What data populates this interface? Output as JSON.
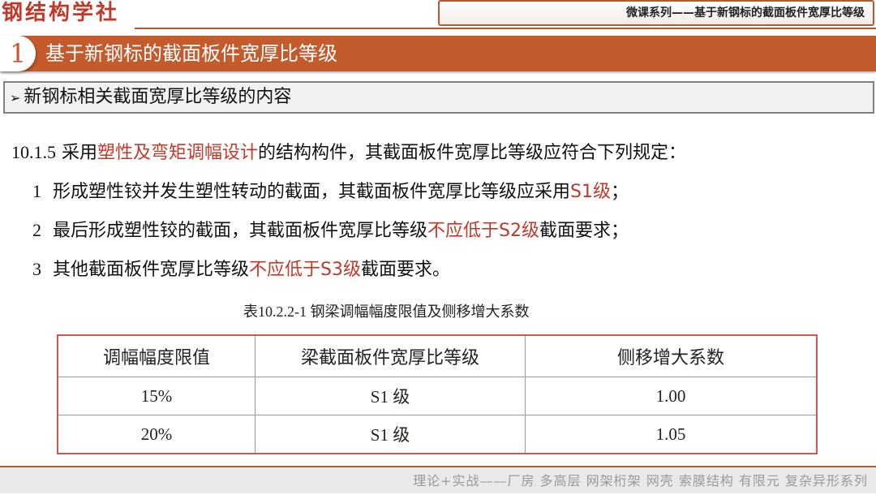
{
  "logo": {
    "text": "钢结构学社"
  },
  "header": {
    "title": "微课系列——基于新钢标的截面板件宽厚比等级"
  },
  "section": {
    "number": "1",
    "title": "基于新钢标的截面板件宽厚比等级"
  },
  "subheading": {
    "arrow": "➢",
    "text": "新钢标相关截面宽厚比等级的内容"
  },
  "paragraphs": [
    {
      "num": "10.1.5",
      "parts": [
        "采用",
        "塑性及弯矩调幅设计",
        "的结构构件，其截面板件宽厚比等级应符合下列规定："
      ]
    },
    {
      "num": "1",
      "parts": [
        "形成塑性铰并发生塑性转动的截面，其截面板件宽厚比等级应采用",
        "S1级",
        "；"
      ]
    },
    {
      "num": "2",
      "parts": [
        "最后形成塑性铰的截面，其截面板件宽厚比等级",
        "不应低于S2级",
        "截面要求；"
      ]
    },
    {
      "num": "3",
      "parts": [
        "其他截面板件宽厚比等级",
        "不应低于S3级",
        "截面要求。"
      ]
    }
  ],
  "table": {
    "caption": "表10.2.2-1  钢梁调幅幅度限值及侧移增大系数",
    "headers": [
      "调幅幅度限值",
      "梁截面板件宽厚比等级",
      "侧移增大系数"
    ],
    "rows": [
      [
        "15%",
        "S1 级",
        "1.00"
      ],
      [
        "20%",
        "S1 级",
        "1.05"
      ]
    ]
  },
  "footer": {
    "text": "理论+实战——厂房 多高层 网架桁架 网壳 索膜结构 有限元 复杂异形系列"
  },
  "colors": {
    "accent": "#c35b2c",
    "highlight": "#c0392b",
    "table_border": "#d9534f"
  }
}
